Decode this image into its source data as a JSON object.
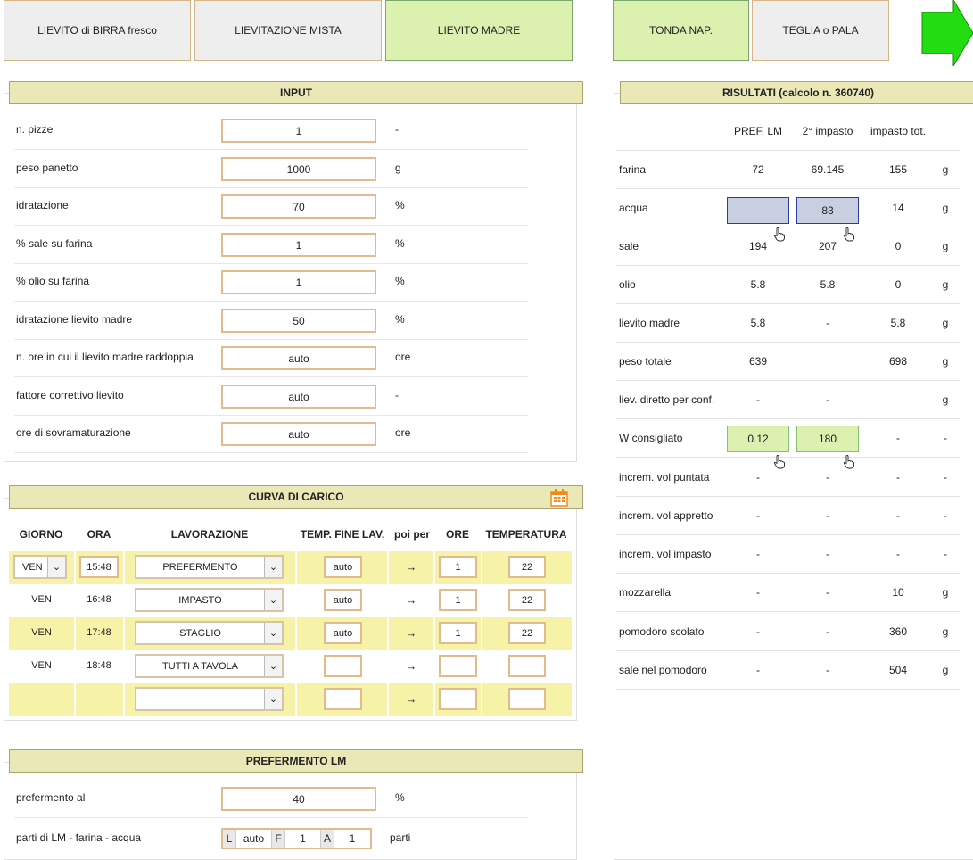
{
  "top_tabs": [
    {
      "label": "LIEVITO di BIRRA fresco",
      "active": false
    },
    {
      "label": "LIEVITAZIONE MISTA",
      "active": false
    },
    {
      "label": "LIEVITO MADRE",
      "active": true
    },
    {
      "label": "TONDA NAP.",
      "active": true
    },
    {
      "label": "TEGLIA o PALA",
      "active": false
    }
  ],
  "next_icon": "arrow-right-icon",
  "input": {
    "title": "INPUT",
    "rows": [
      {
        "label": "n. pizze",
        "value": "1",
        "unit": "-"
      },
      {
        "label": "peso panetto",
        "value": "1000",
        "unit": "g"
      },
      {
        "label": "idratazione",
        "value": "70",
        "unit": "%"
      },
      {
        "label": "% sale su farina",
        "value": "1",
        "unit": "%"
      },
      {
        "label": "% olio su farina",
        "value": "1",
        "unit": "%"
      },
      {
        "label": "idratazione lievito madre",
        "value": "50",
        "unit": "%"
      },
      {
        "label": "n. ore in cui il lievito madre raddoppia",
        "value": "auto",
        "unit": "ore"
      },
      {
        "label": "fattore correttivo lievito",
        "value": "auto",
        "unit": "-"
      },
      {
        "label": "ore di sovramaturazione",
        "value": "auto",
        "unit": "ore"
      }
    ]
  },
  "results": {
    "title": "RISULTATI (calcolo n. 360740)",
    "columns": [
      "PREF. LM",
      "2° impasto",
      "impasto tot."
    ],
    "rows": [
      {
        "label": "farina",
        "c1": "72",
        "c2": "69.145",
        "c3": "155",
        "unit": "g"
      },
      {
        "label": "acqua",
        "c1": "",
        "c2": "83",
        "c3": "14",
        "unit": "g"
      },
      {
        "label": "sale",
        "c1": "194",
        "c2": "207",
        "c3": "0",
        "unit": "g"
      },
      {
        "label": "olio",
        "c1": "5.8",
        "c2": "5.8",
        "c3": "0",
        "unit": "g"
      },
      {
        "label": "lievito madre",
        "c1": "5.8",
        "c2": "-",
        "c3": "5.8",
        "unit": "g"
      },
      {
        "label": "peso totale",
        "c1": "639",
        "c2": "",
        "c3": "698",
        "unit": "g"
      },
      {
        "label": "liev. diretto per conf.",
        "c1": "-",
        "c2": "-",
        "c3": "",
        "unit": "g"
      },
      {
        "label": "W consigliato",
        "c1": "0.12",
        "c2": "180",
        "c3": "-",
        "unit": "-"
      },
      {
        "label": "increm. vol puntata",
        "c1": "-",
        "c2": "-",
        "c3": "-",
        "unit": "-"
      },
      {
        "label": "increm. vol appretto",
        "c1": "-",
        "c2": "-",
        "c3": "-",
        "unit": "-"
      },
      {
        "label": "increm. vol impasto",
        "c1": "-",
        "c2": "-",
        "c3": "-",
        "unit": "-"
      },
      {
        "label": "mozzarella",
        "c1": "-",
        "c2": "-",
        "c3": "10",
        "unit": "g"
      },
      {
        "label": "pomodoro scolato",
        "c1": "-",
        "c2": "-",
        "c3": "360",
        "unit": "g"
      },
      {
        "label": "sale nel pomodoro",
        "c1": "-",
        "c2": "-",
        "c3": "504",
        "unit": "g"
      }
    ]
  },
  "curva": {
    "title": "CURVA DI CARICO",
    "calendar_icon": "calendar-icon",
    "headers": [
      "GIORNO",
      "ORA",
      "LAVORAZIONE",
      "TEMP. FINE LAV.",
      "poi per",
      "ORE",
      "TEMPERATURA"
    ],
    "arrow": "→",
    "rows": [
      {
        "giorno": "VEN",
        "ora": "15:48",
        "lav": "PREFERMENTO",
        "temp": "auto",
        "ore": "1",
        "temperatura": "22"
      },
      {
        "giorno": "VEN",
        "ora": "16:48",
        "lav": "IMPASTO",
        "temp": "auto",
        "ore": "1",
        "temperatura": "22"
      },
      {
        "giorno": "VEN",
        "ora": "17:48",
        "lav": "STAGLIO",
        "temp": "auto",
        "ore": "1",
        "temperatura": "22"
      },
      {
        "giorno": "VEN",
        "ora": "18:48",
        "lav": "TUTTI A TAVOLA",
        "temp": "",
        "ore": "",
        "temperatura": ""
      },
      {
        "giorno": "",
        "ora": "",
        "lav": "",
        "temp": "",
        "ore": "",
        "temperatura": ""
      }
    ]
  },
  "prefermento": {
    "title": "PREFERMENTO LM",
    "row1": {
      "label": "prefermento al",
      "value": "40",
      "unit": "%"
    },
    "row2": {
      "label": "parti di LM - farina - acqua",
      "k1": "L",
      "v1": "auto",
      "k2": "F",
      "v2": "1",
      "k3": "A",
      "v3": "1",
      "unit": "parti"
    }
  },
  "colors": {
    "accent_green": "#dcf0b0",
    "header": "#eae8b6",
    "input_border": "#e0bb8c",
    "row_yellow": "#f6f3a8"
  }
}
